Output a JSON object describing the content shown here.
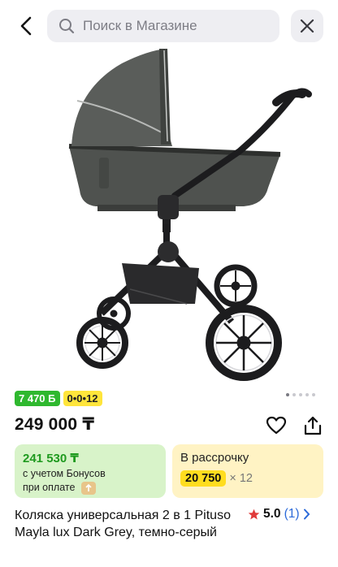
{
  "search": {
    "placeholder": "Поиск в Магазине"
  },
  "icons": {
    "back": "chevron-left-icon",
    "search": "search-icon",
    "close": "close-icon",
    "favorite": "heart-icon",
    "share": "share-icon",
    "star": "star-icon",
    "chevron": "chevron-right-icon",
    "bonus_coin": "bonus-coin-icon"
  },
  "gallery": {
    "total_images": 5,
    "active_index": 0
  },
  "badges": {
    "bonus": "7 470 Б",
    "installment": "0•0•12"
  },
  "product": {
    "price": "249 000 ₸",
    "title": "Коляска универсальная 2 в 1 Pituso Mayla lux Dark Grey, темно-серый",
    "rating": "5.0",
    "reviews": "(1)"
  },
  "bonus_card": {
    "amount": "241 530 ₸",
    "note_line1": "с учетом Бонусов",
    "note_line2": "при оплате"
  },
  "installment_card": {
    "title": "В рассрочку",
    "amount": "20 750",
    "months": "× 12"
  },
  "colors": {
    "accent_green": "#2fb82f",
    "accent_yellow": "#ffe53b",
    "link_blue": "#2c6ad9",
    "star_red": "#e03a3a"
  }
}
